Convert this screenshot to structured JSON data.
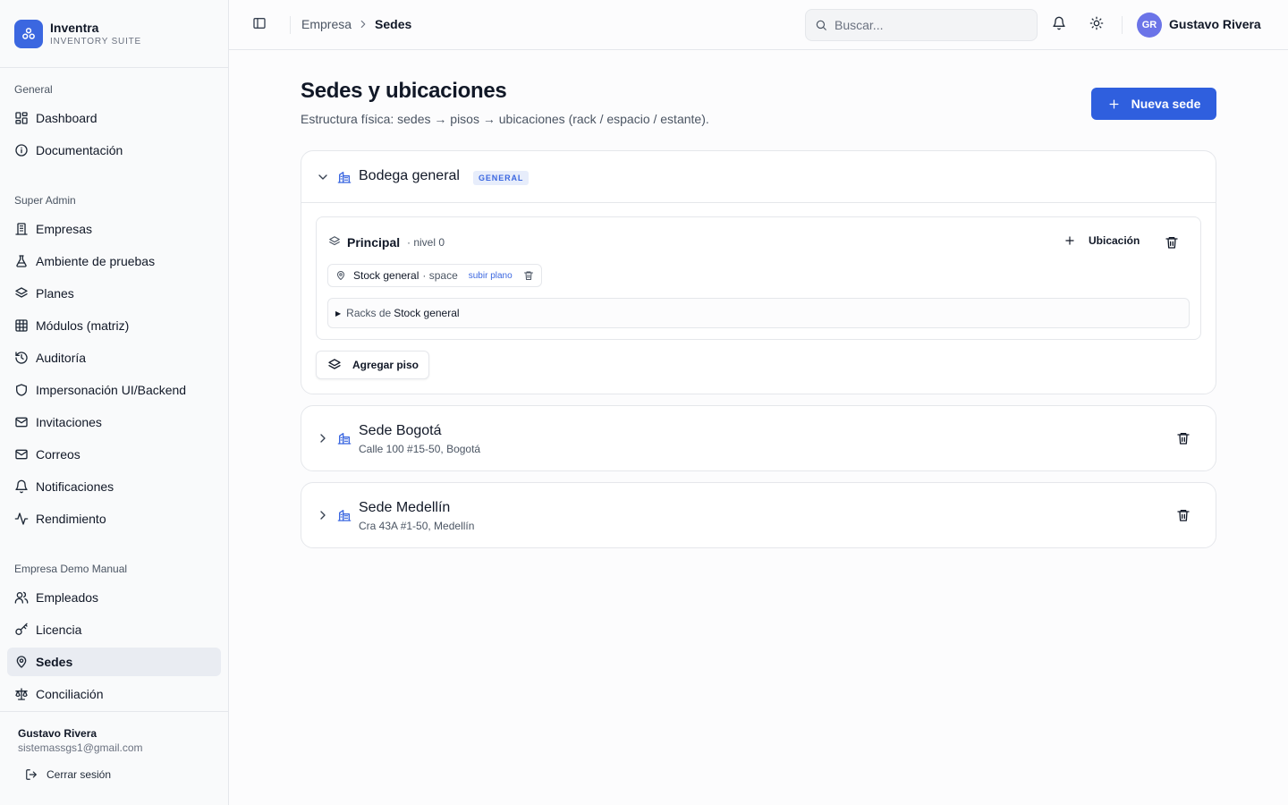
{
  "brand": {
    "name": "Inventra",
    "subtitle": "INVENTORY SUITE"
  },
  "sidebar": {
    "groups": [
      {
        "label": "General"
      },
      {
        "label": "Super Admin"
      },
      {
        "label": "Empresa Demo Manual"
      }
    ],
    "items": [
      {
        "label": "Dashboard",
        "icon": "dashboard-icon"
      },
      {
        "label": "Documentación",
        "icon": "info-icon"
      },
      {
        "label": "Empresas",
        "icon": "building-icon"
      },
      {
        "label": "Ambiente de pruebas",
        "icon": "flask-icon"
      },
      {
        "label": "Planes",
        "icon": "layers-icon"
      },
      {
        "label": "Módulos (matriz)",
        "icon": "table-icon"
      },
      {
        "label": "Auditoría",
        "icon": "history-icon"
      },
      {
        "label": "Impersonación UI/Backend",
        "icon": "shield-icon"
      },
      {
        "label": "Invitaciones",
        "icon": "mail-icon"
      },
      {
        "label": "Correos",
        "icon": "mail-icon"
      },
      {
        "label": "Notificaciones",
        "icon": "bell-icon"
      },
      {
        "label": "Rendimiento",
        "icon": "activity-icon"
      },
      {
        "label": "Empleados",
        "icon": "users-icon"
      },
      {
        "label": "Licencia",
        "icon": "key-icon"
      },
      {
        "label": "Sedes",
        "icon": "map-pin-icon",
        "active": true
      },
      {
        "label": "Conciliación",
        "icon": "scale-icon"
      }
    ],
    "footer": {
      "user_name": "Gustavo Rivera",
      "user_email": "sistemassgs1@gmail.com",
      "logout_label": "Cerrar sesión"
    }
  },
  "header": {
    "breadcrumb_parent": "Empresa",
    "breadcrumb_current": "Sedes",
    "search_placeholder": "Buscar...",
    "avatar_initials": "GR",
    "user_name": "Gustavo Rivera"
  },
  "page": {
    "title": "Sedes y ubicaciones",
    "subtitle": "Estructura física: sedes → pisos → ubicaciones (rack / espacio / estante).",
    "new_button": "Nueva sede"
  },
  "sedes": [
    {
      "name": "Bodega general",
      "badge": "GENERAL",
      "expanded": true,
      "floor": {
        "name": "Principal",
        "level": "· nivel 0",
        "add_location_label": "Ubicación",
        "location": {
          "name": "Stock general",
          "type": "· space",
          "upload_label": "subir plano"
        },
        "racks_prefix": "Racks de",
        "racks_location": "Stock general"
      },
      "add_floor_label": "Agregar piso"
    },
    {
      "name": "Sede Bogotá",
      "address": "Calle 100 #15-50, Bogotá",
      "expanded": false
    },
    {
      "name": "Sede Medellín",
      "address": "Cra 43A #1-50, Medellín",
      "expanded": false
    }
  ],
  "colors": {
    "accent": "#2f5fde",
    "badge_bg": "#e7edfb",
    "active_nav": "#e9ecf2"
  }
}
